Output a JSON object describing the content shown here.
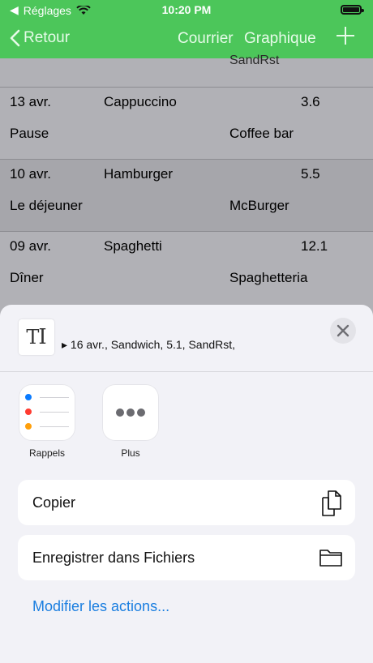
{
  "status_bar": {
    "carrier": "Réglages",
    "time": "10:20 PM"
  },
  "nav": {
    "back": "Retour",
    "link1": "Courrier",
    "link2": "Graphique"
  },
  "list": {
    "partial_text": "SandRst",
    "rows": [
      {
        "date": "13 avr.",
        "name": "Cappuccino",
        "amount": "3.6",
        "category": "Pause",
        "place": "Coffee bar"
      },
      {
        "date": "10 avr.",
        "name": "Hamburger",
        "amount": "5.5",
        "category": "Le déjeuner",
        "place": "McBurger"
      },
      {
        "date": "09 avr.",
        "name": "Spaghetti",
        "amount": "12.1",
        "category": "Dîner",
        "place": "Spaghetteria"
      }
    ]
  },
  "share_sheet": {
    "preview": "▸ 16 avr., Sandwich, 5.1, SandRst,",
    "apps": [
      {
        "label": "Rappels"
      },
      {
        "label": "Plus"
      }
    ],
    "actions": [
      {
        "label": "Copier",
        "icon": "copy-icon"
      },
      {
        "label": "Enregistrer dans Fichiers",
        "icon": "folder-icon"
      }
    ],
    "edit_link": "Modifier les actions..."
  },
  "colors": {
    "header": "#4cc65a",
    "link": "#1a7ee0"
  }
}
